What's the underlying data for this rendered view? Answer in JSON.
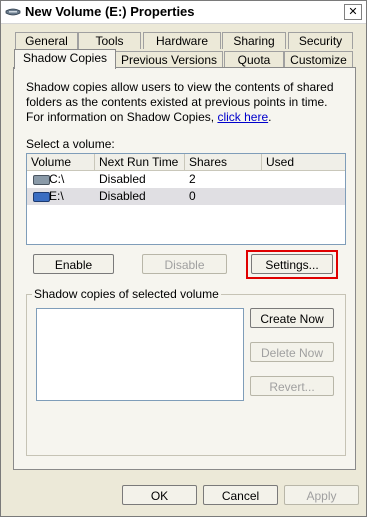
{
  "window": {
    "title": "New Volume (E:) Properties",
    "close_glyph": "✕"
  },
  "tabs_row1": [
    {
      "label": "General"
    },
    {
      "label": "Tools"
    },
    {
      "label": "Hardware"
    },
    {
      "label": "Sharing"
    },
    {
      "label": "Security"
    }
  ],
  "tabs_row2": [
    {
      "label": "Shadow Copies",
      "active": true
    },
    {
      "label": "Previous Versions"
    },
    {
      "label": "Quota"
    },
    {
      "label": "Customize"
    }
  ],
  "shadow_copies": {
    "description": "Shadow copies allow users to view the contents of shared folders as the contents existed at previous points in time. For information on Shadow Copies, ",
    "link_text": "click here",
    "link_suffix": ".",
    "select_volume_label": "Select a volume:",
    "columns": [
      "Volume",
      "Next Run Time",
      "Shares",
      "Used"
    ],
    "volumes": [
      {
        "volume": "C:\\",
        "next_run": "Disabled",
        "shares": "2",
        "used": "",
        "selected": false,
        "icon": "drive-c-icon"
      },
      {
        "volume": "E:\\",
        "next_run": "Disabled",
        "shares": "0",
        "used": "",
        "selected": true,
        "icon": "drive-e-icon"
      }
    ],
    "buttons": {
      "enable": "Enable",
      "disable": "Disable",
      "settings": "Settings..."
    },
    "group_title": "Shadow copies of selected volume",
    "side_buttons": {
      "create_now": "Create Now",
      "delete_now": "Delete Now",
      "revert": "Revert..."
    }
  },
  "footer": {
    "ok": "OK",
    "cancel": "Cancel",
    "apply": "Apply"
  },
  "colors": {
    "highlight": "#e00000",
    "link": "#0000cc",
    "drive_e": "#3a6dc2",
    "drive_c": "#8a9aa8"
  }
}
